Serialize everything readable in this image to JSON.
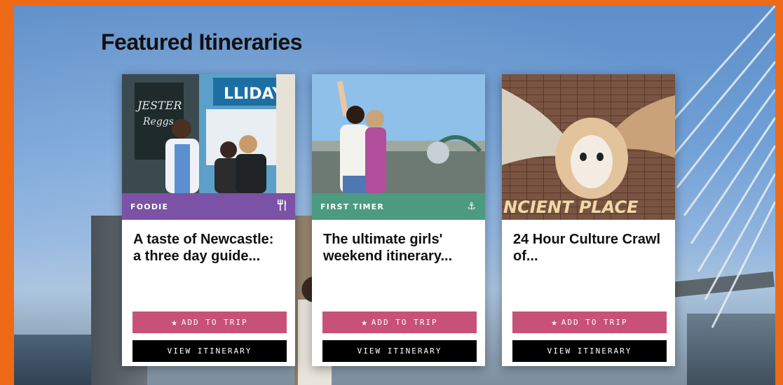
{
  "section": {
    "title": "Featured Itineraries"
  },
  "colors": {
    "page_border": "#ef6a16",
    "add_button": "#c85178",
    "view_button": "#000000",
    "foodie_tag": "#7b52a6",
    "first_timer_tag": "#4c9a7f"
  },
  "cards": [
    {
      "tag": "FOODIE",
      "tag_icon": "fork-knife-icon",
      "title": "A taste of Newcastle: a three day guide...",
      "add_label": "ADD TO TRIP",
      "view_label": "VIEW ITINERARY",
      "image": "friends-eating-street-food"
    },
    {
      "tag": "FIRST TIMER",
      "tag_icon": "anchor-icon",
      "title": "The ultimate girls' weekend itinerary...",
      "add_label": "ADD TO TRIP",
      "view_label": "VIEW ITINERARY",
      "image": "women-selfie-tyne-bridge"
    },
    {
      "tag": "",
      "tag_icon": "",
      "title": "24 Hour Culture Crawl of...",
      "add_label": "ADD TO TRIP",
      "view_label": "VIEW ITINERARY",
      "image": "barn-owl-mural",
      "image_text": "NCIENT PLACE"
    }
  ]
}
